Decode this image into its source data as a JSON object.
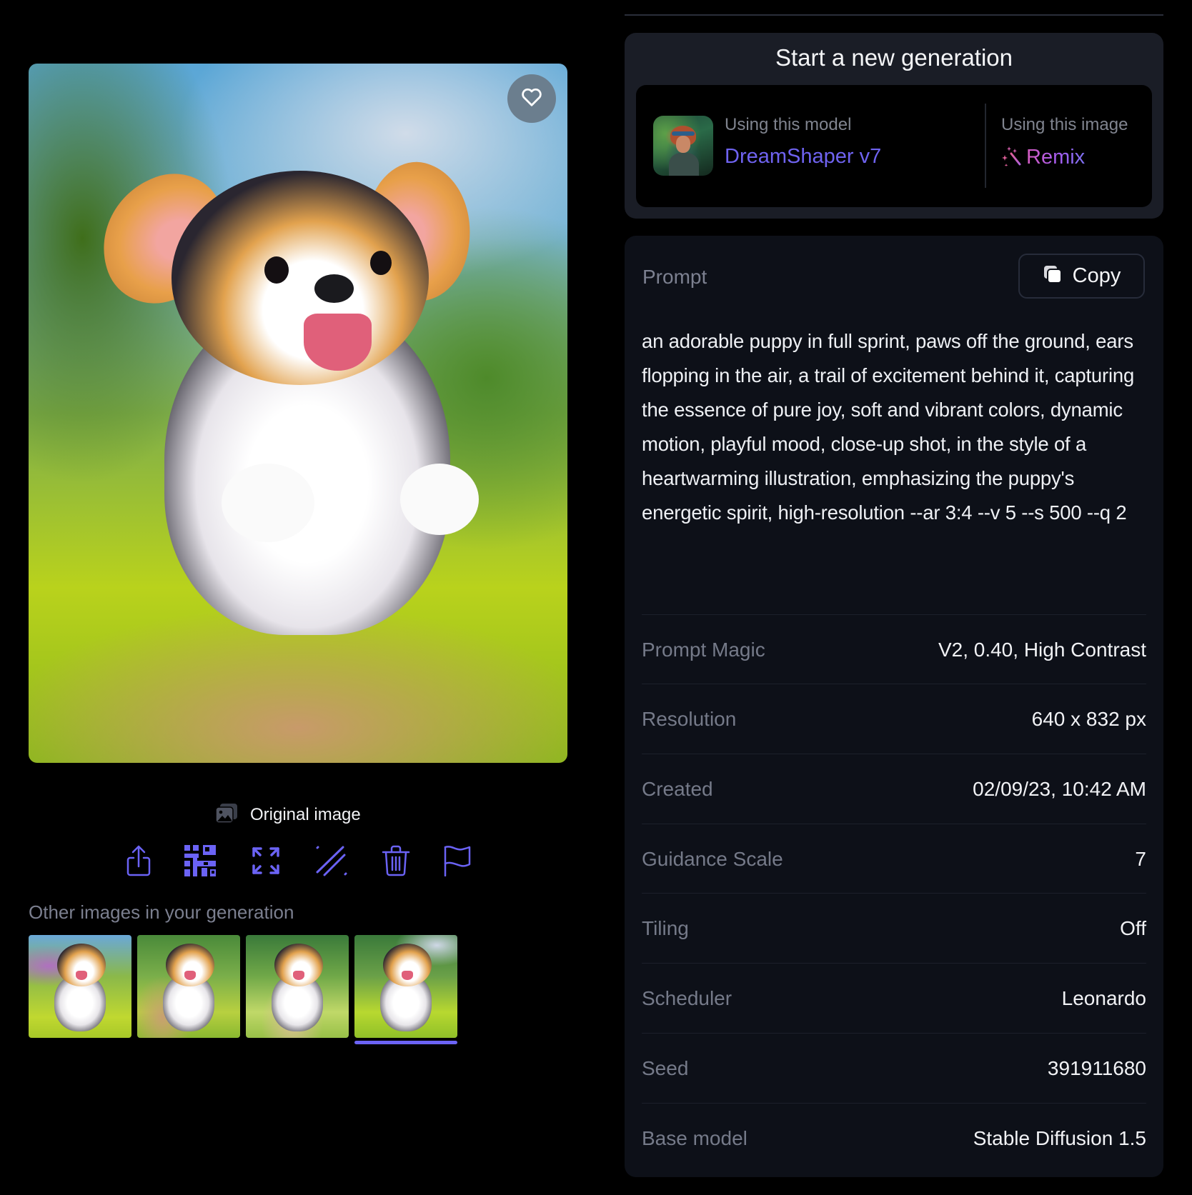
{
  "main_image": {
    "favorite_icon": "heart-outline-icon",
    "original_image_label": "Original image",
    "original_image_icon": "images-stack-icon"
  },
  "actions": [
    {
      "name": "share",
      "icon": "share-upload-icon"
    },
    {
      "name": "qr-pattern",
      "icon": "pattern-grid-icon"
    },
    {
      "name": "expand",
      "icon": "expand-arrows-icon"
    },
    {
      "name": "unzoom",
      "icon": "diagonal-lines-icon"
    },
    {
      "name": "delete",
      "icon": "trash-icon"
    },
    {
      "name": "report",
      "icon": "flag-icon"
    }
  ],
  "other_images": {
    "label": "Other images in your generation",
    "count": 4,
    "selected_index": 3
  },
  "generation": {
    "title": "Start a new generation",
    "model_caption": "Using this model",
    "model_name": "DreamShaper v7",
    "image_caption": "Using this image",
    "remix_label": "Remix",
    "remix_icon": "magic-wand-sparkles-icon"
  },
  "details": {
    "prompt_label": "Prompt",
    "copy_label": "Copy",
    "copy_icon": "copy-icon",
    "prompt_text": "an adorable puppy in full sprint, paws off the ground, ears flopping in the air, a trail of excitement behind it, capturing the essence of pure joy, soft and vibrant colors, dynamic motion, playful mood, close-up shot, in the style of a heartwarming illustration, emphasizing the puppy's energetic spirit, high-resolution --ar 3:4 --v 5 --s 500 --q 2",
    "rows": [
      {
        "label": "Prompt Magic",
        "value": "V2, 0.40, High Contrast"
      },
      {
        "label": "Resolution",
        "value": "640 x 832 px"
      },
      {
        "label": "Created",
        "value": "02/09/23, 10:42 AM"
      },
      {
        "label": "Guidance Scale",
        "value": "7"
      },
      {
        "label": "Tiling",
        "value": "Off"
      },
      {
        "label": "Scheduler",
        "value": "Leonardo"
      },
      {
        "label": "Seed",
        "value": "391911680"
      },
      {
        "label": "Base model",
        "value": "Stable Diffusion 1.5"
      }
    ]
  },
  "colors": {
    "accent": "#6b63f5",
    "model_link": "#6f63f0",
    "remix_gradient": [
      "#d55cc0",
      "#a45cf0",
      "#7c70f0"
    ],
    "card_bg": "#1a1d26",
    "details_bg": "#0d1018"
  }
}
